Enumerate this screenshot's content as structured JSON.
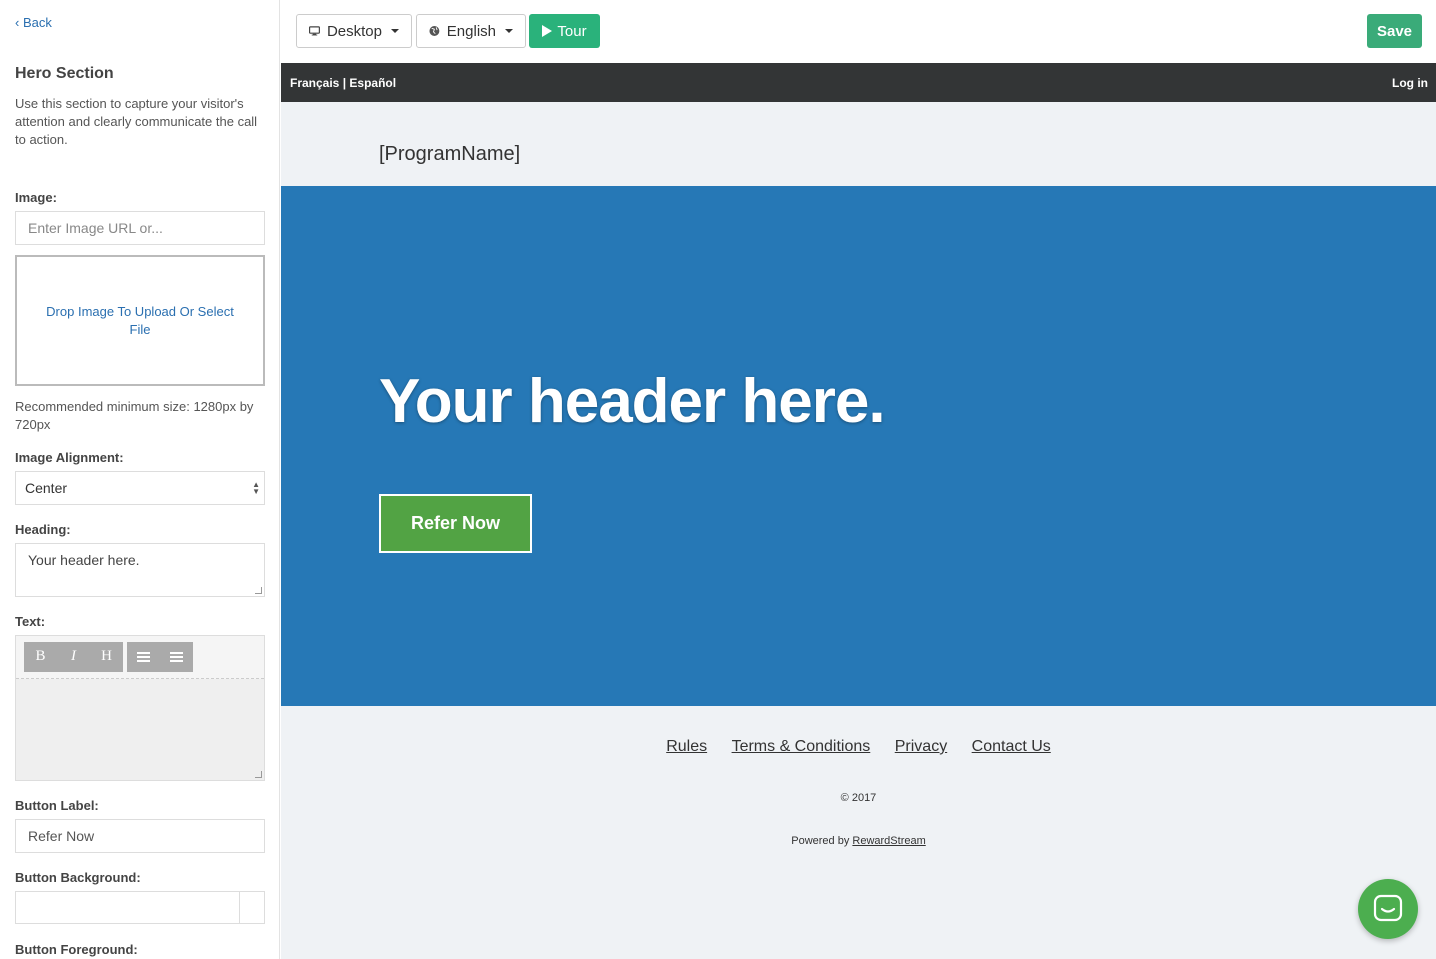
{
  "sidebar": {
    "back_label": "Back",
    "title": "Hero Section",
    "description": "Use this section to capture your visitor's attention and clearly communicate the call to action.",
    "image_label": "Image:",
    "image_placeholder": "Enter Image URL or...",
    "dropzone_text": "Drop Image To Upload Or Select File",
    "size_hint": "Recommended minimum size: 1280px by 720px",
    "alignment_label": "Image Alignment:",
    "alignment_value": "Center",
    "heading_label": "Heading:",
    "heading_value": "Your header here.",
    "text_label": "Text:",
    "toolbar": {
      "bold": "B",
      "italic": "I",
      "heading": "H"
    },
    "button_label_label": "Button Label:",
    "button_label_value": "Refer Now",
    "button_bg_label": "Button Background:",
    "button_fg_label": "Button Foreground:"
  },
  "topbar": {
    "device_label": "Desktop",
    "language_label": "English",
    "tour_label": "Tour",
    "save_label": "Save"
  },
  "preview": {
    "languages": "Français | Español",
    "login_label": "Log in",
    "program_name": "[ProgramName]",
    "hero_heading": "Your header here.",
    "cta_label": "Refer Now",
    "footer_links": [
      "Rules",
      "Terms & Conditions",
      "Privacy",
      "Contact Us"
    ],
    "copyright": "© 2017",
    "powered_prefix": "Powered by ",
    "powered_link": "RewardStream"
  },
  "colors": {
    "accent_green": "#2ab27b",
    "hero_blue": "#2678b6",
    "cta_green": "#52a344",
    "lang_bar": "#333536",
    "link_blue": "#2a6fb0"
  },
  "icons": [
    "chevron-left-icon",
    "monitor-icon",
    "globe-icon",
    "play-icon",
    "list-icon",
    "chat-icon"
  ]
}
